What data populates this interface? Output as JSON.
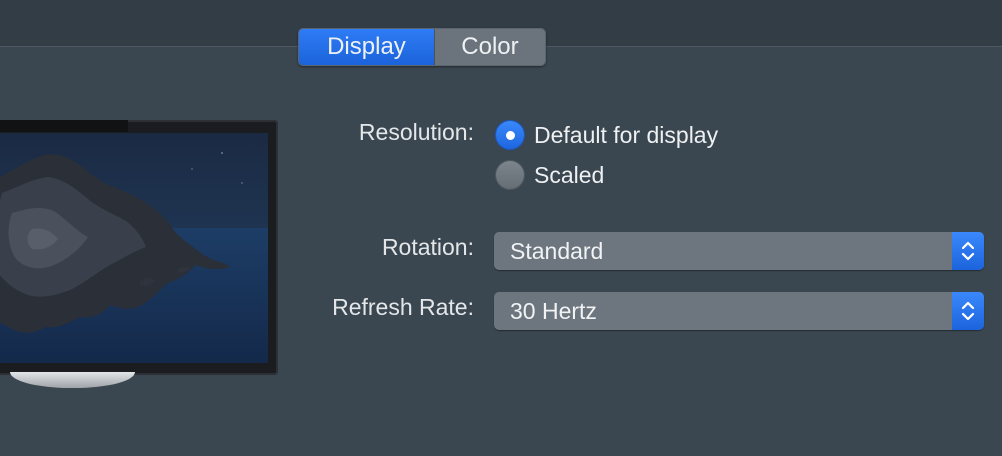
{
  "tabs": [
    {
      "label": "Display",
      "selected": true
    },
    {
      "label": "Color",
      "selected": false
    }
  ],
  "resolution": {
    "label": "Resolution:",
    "options": [
      {
        "label": "Default for display",
        "selected": true
      },
      {
        "label": "Scaled",
        "selected": false
      }
    ]
  },
  "rotation": {
    "label": "Rotation:",
    "value": "Standard"
  },
  "refresh_rate": {
    "label": "Refresh Rate:",
    "value": "30 Hertz"
  },
  "icons": {
    "popup_stepper": "chevron-up-down-icon"
  },
  "colors": {
    "accent": "#1e6ce6",
    "background": "#3b4750",
    "control": "#6d767e"
  }
}
